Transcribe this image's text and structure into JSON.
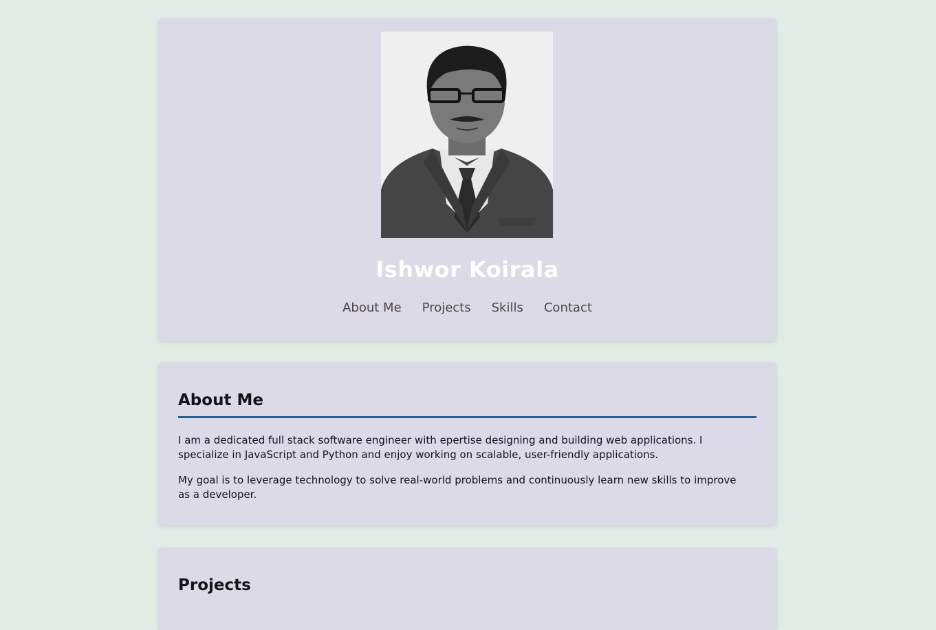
{
  "header": {
    "name": "Ishwor Koirala",
    "nav": [
      {
        "label": "About Me"
      },
      {
        "label": "Projects"
      },
      {
        "label": "Skills"
      },
      {
        "label": "Contact"
      }
    ]
  },
  "about": {
    "title": "About Me",
    "paragraphs": [
      "I am a dedicated full stack software engineer with epertise designing and building web applications. I specialize in JavaScript and Python and enjoy working on scalable, user-friendly applications.",
      "My goal is to leverage technology to solve real-world problems and continuously learn new skills to improve as a developer."
    ]
  },
  "projects": {
    "title": "Projects"
  },
  "colors": {
    "page_background": "#e0ece4",
    "card_background": "#dcdae6",
    "accent_rule": "#1f5f99",
    "name_text": "#ffffff",
    "nav_text": "#4d4448"
  }
}
